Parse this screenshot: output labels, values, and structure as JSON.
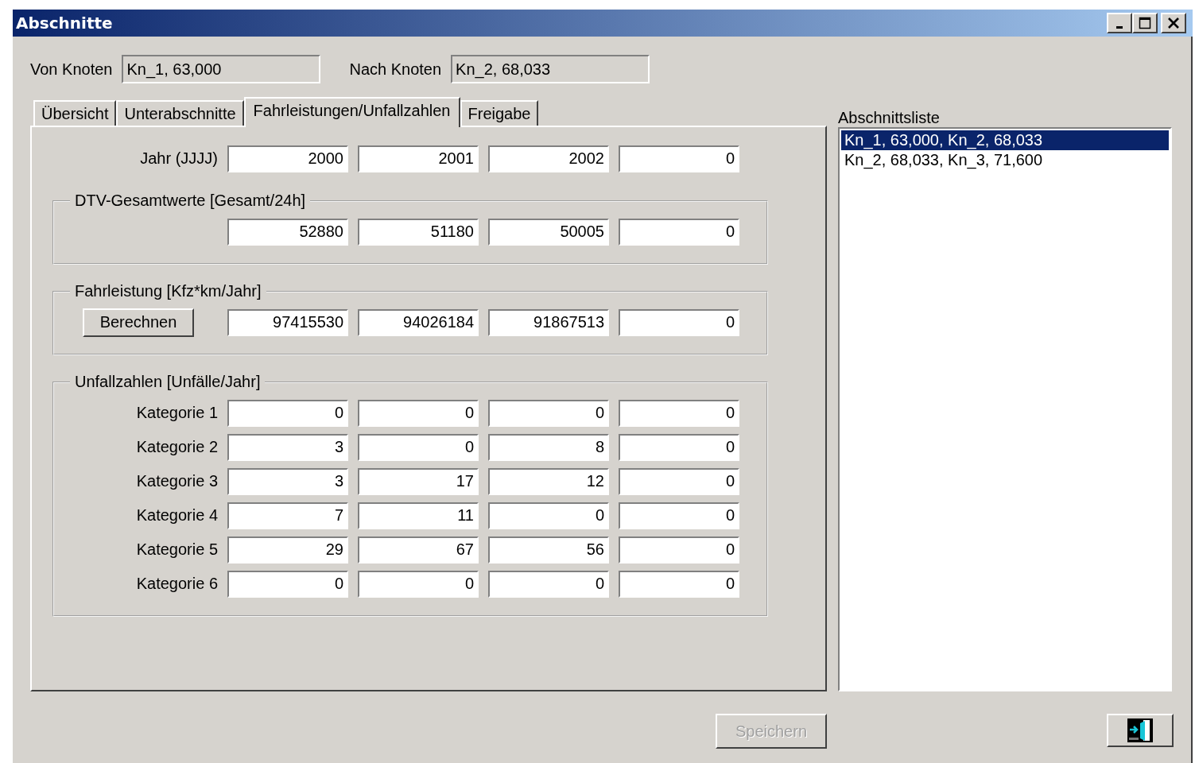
{
  "window": {
    "title": "Abschnitte"
  },
  "from_node": {
    "label": "Von Knoten",
    "value": "Kn_1, 63,000"
  },
  "to_node": {
    "label": "Nach Knoten",
    "value": "Kn_2, 68,033"
  },
  "tabs": [
    {
      "label": "Übersicht",
      "selected": false
    },
    {
      "label": "Unterabschnitte",
      "selected": false
    },
    {
      "label": "Fahrleistungen/Unfallzahlen",
      "selected": true
    },
    {
      "label": "Freigabe",
      "selected": false
    }
  ],
  "year_row": {
    "label": "Jahr (JJJJ)",
    "values": [
      "2000",
      "2001",
      "2002",
      "0"
    ]
  },
  "groups": [
    {
      "title": "DTV-Gesamtwerte [Gesamt/24h]",
      "rows": [
        {
          "kind": "plain",
          "values": [
            "52880",
            "51180",
            "50005",
            "0"
          ]
        }
      ]
    },
    {
      "title": "Fahrleistung [Kfz*km/Jahr]",
      "rows": [
        {
          "kind": "button",
          "button": "Berechnen",
          "values": [
            "97415530",
            "94026184",
            "91867513",
            "0"
          ]
        }
      ]
    },
    {
      "title": "Unfallzahlen [Unfälle/Jahr]",
      "rows": [
        {
          "kind": "label",
          "label": "Kategorie 1",
          "values": [
            "0",
            "0",
            "0",
            "0"
          ]
        },
        {
          "kind": "label",
          "label": "Kategorie 2",
          "values": [
            "3",
            "0",
            "8",
            "0"
          ]
        },
        {
          "kind": "label",
          "label": "Kategorie 3",
          "values": [
            "3",
            "17",
            "12",
            "0"
          ]
        },
        {
          "kind": "label",
          "label": "Kategorie 4",
          "values": [
            "7",
            "11",
            "0",
            "0"
          ]
        },
        {
          "kind": "label",
          "label": "Kategorie 5",
          "values": [
            "29",
            "67",
            "56",
            "0"
          ]
        },
        {
          "kind": "label",
          "label": "Kategorie 6",
          "values": [
            "0",
            "0",
            "0",
            "0"
          ]
        }
      ]
    }
  ],
  "section_list": {
    "label": "Abschnittsliste",
    "items": [
      {
        "text": "Kn_1, 63,000, Kn_2, 68,033",
        "selected": true
      },
      {
        "text": "Kn_2, 68,033, Kn_3, 71,600",
        "selected": false
      }
    ]
  },
  "save_button": {
    "label": "Speichern",
    "disabled": true
  }
}
